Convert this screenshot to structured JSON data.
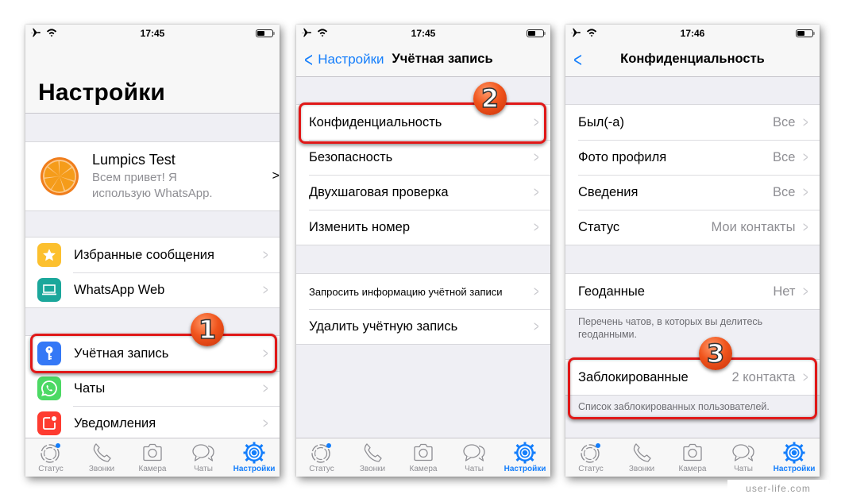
{
  "colors": {
    "accent": "#147efb",
    "highlight": "#e01818",
    "badge": "#f0541c",
    "secondary_text": "#8e8e93",
    "chevron": "#c7c7cc",
    "group_bg": "#efeff4"
  },
  "tabbar": {
    "tabs": [
      {
        "label": "Статус",
        "icon": "status-icon"
      },
      {
        "label": "Звонки",
        "icon": "phone-icon"
      },
      {
        "label": "Камера",
        "icon": "camera-icon"
      },
      {
        "label": "Чаты",
        "icon": "chats-icon"
      },
      {
        "label": "Настройки",
        "icon": "settings-gear-icon",
        "active": true
      }
    ]
  },
  "screens": [
    {
      "status": {
        "time": "17:45",
        "icons": [
          "airplane-icon",
          "wifi-icon",
          "battery-icon"
        ]
      },
      "title": "Настройки",
      "profile": {
        "name": "Lumpics Test",
        "about_line1": "Всем привет! Я",
        "about_line2": "использую WhatsApp.",
        "avatar": "orange-slice-avatar"
      },
      "group1": [
        {
          "label": "Избранные сообщения",
          "icon": "star-icon",
          "icon_color": "#fcc02e"
        },
        {
          "label": "WhatsApp Web",
          "icon": "laptop-icon",
          "icon_color": "#1ba79b"
        }
      ],
      "group2": [
        {
          "label": "Учётная запись",
          "icon": "key-icon",
          "icon_color": "#3478f6"
        },
        {
          "label": "Чаты",
          "icon": "whatsapp-icon",
          "icon_color": "#4cd964"
        },
        {
          "label": "Уведомления",
          "icon": "notification-icon",
          "icon_color": "#fe3b30"
        }
      ],
      "step": "1"
    },
    {
      "status": {
        "time": "17:45",
        "icons": [
          "airplane-icon",
          "wifi-icon",
          "battery-icon"
        ]
      },
      "back_label": "Настройки",
      "title": "Учётная запись",
      "group1": [
        {
          "label": "Конфиденциальность"
        },
        {
          "label": "Безопасность"
        },
        {
          "label": "Двухшаговая проверка"
        },
        {
          "label": "Изменить номер"
        }
      ],
      "group2": [
        {
          "label": "Запросить информацию учётной записи"
        },
        {
          "label": "Удалить учётную запись"
        }
      ],
      "step": "2"
    },
    {
      "status": {
        "time": "17:46",
        "icons": [
          "airplane-icon",
          "wifi-icon",
          "battery-icon"
        ]
      },
      "title": "Конфиденциальность",
      "group1": [
        {
          "label": "Был(-а)",
          "value": "Все"
        },
        {
          "label": "Фото профиля",
          "value": "Все"
        },
        {
          "label": "Сведения",
          "value": "Все"
        },
        {
          "label": "Статус",
          "value": "Мои контакты"
        }
      ],
      "group2": [
        {
          "label": "Геоданные",
          "value": "Нет"
        }
      ],
      "group2_footer": "Перечень чатов, в которых вы делитесь геоданными.",
      "group3": [
        {
          "label": "Заблокированные",
          "value": "2 контакта"
        }
      ],
      "group3_footer": "Список заблокированных пользователей.",
      "step": "3"
    }
  ],
  "watermark": "user-life.com"
}
